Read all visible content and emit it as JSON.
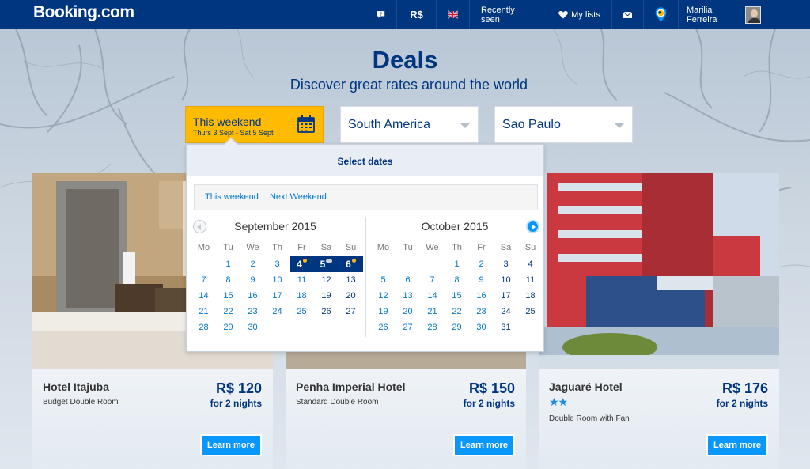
{
  "brand": {
    "name": "Booking",
    "tld": ".com"
  },
  "nav": {
    "currency": "R$",
    "recently_seen": "Recently seen",
    "my_lists": "My lists",
    "user_name": "Marilia Ferreira"
  },
  "hero": {
    "title": "Deals",
    "subtitle": "Discover great rates around the world"
  },
  "filters": {
    "date_main": "This weekend",
    "date_sub": "Thurs 3 Sept - Sat 5 Sept",
    "region": "South America",
    "city": "Sao Paulo"
  },
  "calendar": {
    "header": "Select dates",
    "quick_links": [
      "This weekend",
      "Next Weekend"
    ],
    "weekdays": [
      "Mo",
      "Tu",
      "We",
      "Th",
      "Fr",
      "Sa",
      "Su"
    ],
    "months": [
      {
        "name": "September 2015",
        "offset": 1,
        "days": 30,
        "selected": [
          4,
          5,
          6
        ]
      },
      {
        "name": "October 2015",
        "offset": 3,
        "days": 31,
        "selected": []
      }
    ]
  },
  "hotels": [
    {
      "name": "Hotel Itajuba",
      "room": "Budget Double Room",
      "price": "R$ 120",
      "per": "for 2 nights",
      "stars": "",
      "cta": "Learn more"
    },
    {
      "name": "Penha Imperial Hotel",
      "room": "Standard Double Room",
      "price": "R$ 150",
      "per": "for 2 nights",
      "stars": "",
      "cta": "Learn more"
    },
    {
      "name": "Jaguaré Hotel",
      "room": "Double Room with Fan",
      "price": "R$ 176",
      "per": "for 2 nights",
      "stars": "★★",
      "cta": "Learn more"
    }
  ],
  "colors": {
    "brand_blue": "#003580",
    "accent_yellow": "#febb02",
    "button_blue": "#0896ff"
  }
}
